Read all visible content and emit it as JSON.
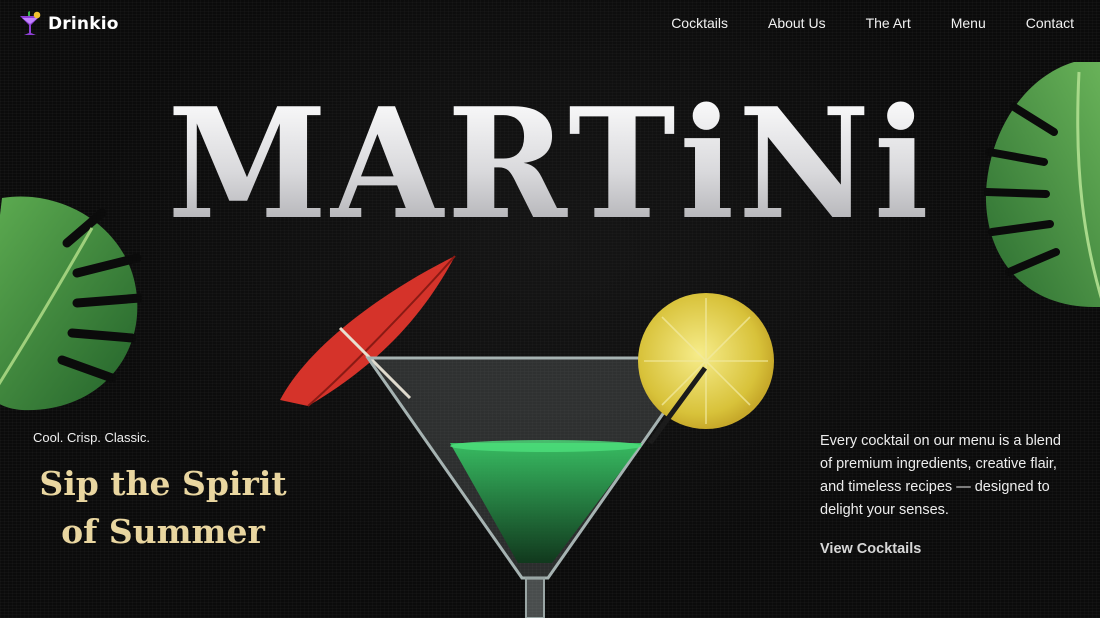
{
  "brand": {
    "name": "Drinkio",
    "logo_icon": "cocktail-glass-icon",
    "accent": "#8e3fd6"
  },
  "nav": {
    "items": [
      {
        "label": "Cocktails"
      },
      {
        "label": "About Us"
      },
      {
        "label": "The Art"
      },
      {
        "label": "Menu"
      },
      {
        "label": "Contact"
      }
    ]
  },
  "hero": {
    "title": "MARTiNi",
    "tagline": "Cool. Crisp. Classic.",
    "headline_line1": "Sip the Spirit",
    "headline_line2": "of Summer",
    "headline_color": "#e9d6a0",
    "description": "Every cocktail on our menu is a blend of premium ingredients, creative flair, and timeless recipes — designed to delight your senses.",
    "cta_label": "View Cocktails"
  },
  "colors": {
    "background": "#0b0b0b",
    "leaf": "#3f8a3c",
    "umbrella": "#e0352b",
    "lemon": "#e6d24a",
    "drink": "#1fa94a"
  }
}
